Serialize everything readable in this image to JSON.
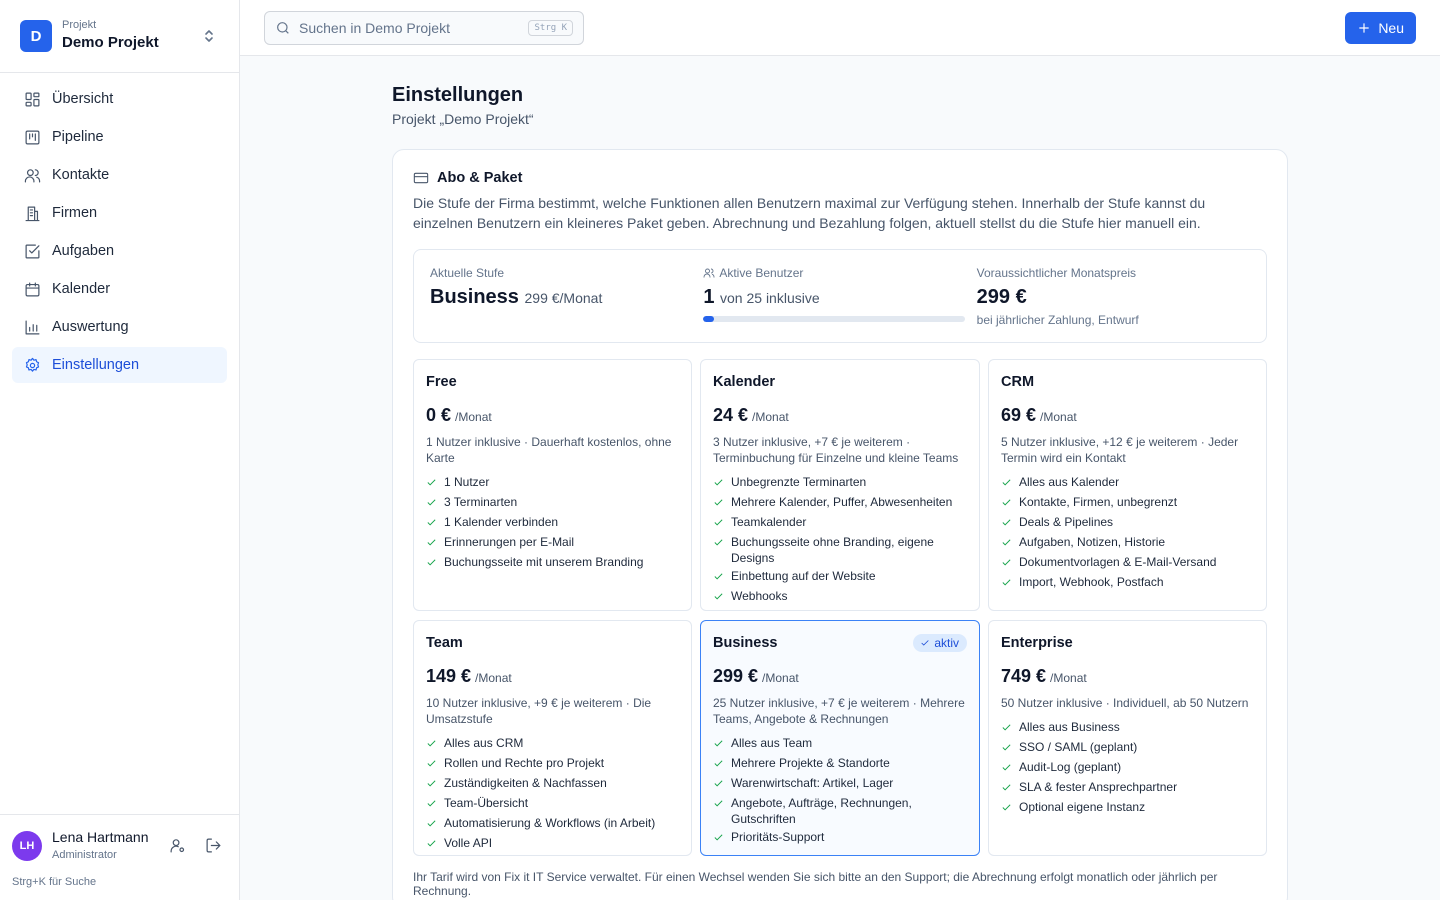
{
  "project": {
    "label": "Projekt",
    "name": "Demo Projekt",
    "initial": "D"
  },
  "nav": [
    {
      "label": "Übersicht",
      "icon": "dashboard-icon"
    },
    {
      "label": "Pipeline",
      "icon": "pipeline-icon"
    },
    {
      "label": "Kontakte",
      "icon": "contacts-icon"
    },
    {
      "label": "Firmen",
      "icon": "building-icon"
    },
    {
      "label": "Aufgaben",
      "icon": "checkbox-icon"
    },
    {
      "label": "Kalender",
      "icon": "calendar-icon"
    },
    {
      "label": "Auswertung",
      "icon": "chart-icon"
    },
    {
      "label": "Einstellungen",
      "icon": "gear-icon",
      "active": true
    }
  ],
  "user": {
    "initials": "LH",
    "name": "Lena Hartmann",
    "role": "Administrator"
  },
  "hint": "Strg+K für Suche",
  "search": {
    "placeholder": "Suchen in Demo Projekt",
    "shortcut": "Strg K"
  },
  "new_button": "Neu",
  "page": {
    "title": "Einstellungen",
    "subtitle": "Projekt „Demo Projekt“"
  },
  "card": {
    "title": "Abo & Paket",
    "description": "Die Stufe der Firma bestimmt, welche Funktionen allen Benutzern maximal zur Verfügung stehen. Innerhalb der Stufe kannst du einzelnen Benutzern ein kleineres Paket geben. Abrechnung und Bezahlung folgen, aktuell stellst du die Stufe hier manuell ein."
  },
  "stats": {
    "tier": {
      "label": "Aktuelle Stufe",
      "value": "Business",
      "price": "299 €/Monat"
    },
    "users": {
      "label": "Aktive Benutzer",
      "value": "1",
      "suffix": "von 25 inklusive",
      "progress": 0.04
    },
    "monthly": {
      "label": "Voraussichtlicher Monatspreis",
      "value": "299 €",
      "note": "bei jährlicher Zahlung, Entwurf"
    }
  },
  "plans": [
    {
      "name": "Free",
      "price": "0 €",
      "per": "/Monat",
      "desc": "1 Nutzer inklusive · Dauerhaft kostenlos, ohne Karte",
      "features": [
        "1 Nutzer",
        "3 Terminarten",
        "1 Kalender verbinden",
        "Erinnerungen per E-Mail",
        "Buchungsseite mit unserem Branding"
      ]
    },
    {
      "name": "Kalender",
      "price": "24 €",
      "per": "/Monat",
      "desc": "3 Nutzer inklusive, +7 € je weiterem · Terminbuchung für Einzelne und kleine Teams",
      "features": [
        "Unbegrenzte Terminarten",
        "Mehrere Kalender, Puffer, Abwesenheiten",
        "Teamkalender",
        "Buchungsseite ohne Branding, eigene Designs",
        "Einbettung auf der Website",
        "Webhooks"
      ]
    },
    {
      "name": "CRM",
      "price": "69 €",
      "per": "/Monat",
      "desc": "5 Nutzer inklusive, +12 € je weiterem · Jeder Termin wird ein Kontakt",
      "features": [
        "Alles aus Kalender",
        "Kontakte, Firmen, unbegrenzt",
        "Deals & Pipelines",
        "Aufgaben, Notizen, Historie",
        "Dokumentvorlagen & E-Mail-Versand",
        "Import, Webhook, Postfach"
      ]
    },
    {
      "name": "Team",
      "price": "149 €",
      "per": "/Monat",
      "desc": "10 Nutzer inklusive, +9 € je weiterem · Die Umsatzstufe",
      "features": [
        "Alles aus CRM",
        "Rollen und Rechte pro Projekt",
        "Zuständigkeiten & Nachfassen",
        "Team-Übersicht",
        "Automatisierung & Workflows (in Arbeit)",
        "Volle API"
      ]
    },
    {
      "name": "Business",
      "price": "299 €",
      "per": "/Monat",
      "badge": "aktiv",
      "active": true,
      "desc": "25 Nutzer inklusive, +7 € je weiterem · Mehrere Teams, Angebote & Rechnungen",
      "features": [
        "Alles aus Team",
        "Mehrere Projekte & Standorte",
        "Warenwirtschaft: Artikel, Lager",
        "Angebote, Aufträge, Rechnungen, Gutschriften",
        "Prioritäts-Support"
      ]
    },
    {
      "name": "Enterprise",
      "price": "749 €",
      "per": "/Monat",
      "desc": "50 Nutzer inklusive · Individuell, ab 50 Nutzern",
      "features": [
        "Alles aus Business",
        "SSO / SAML (geplant)",
        "Audit-Log (geplant)",
        "SLA & fester Ansprechpartner",
        "Optional eigene Instanz"
      ]
    }
  ],
  "footnote": "Ihr Tarif wird von Fix it IT Service verwaltet. Für einen Wechsel wenden Sie sich bitte an den Support; die Abrechnung erfolgt monatlich oder jährlich per Rechnung.",
  "colors": {
    "accent": "#2563eb",
    "check": "#16a34a",
    "avatar": "#7c3aed"
  }
}
